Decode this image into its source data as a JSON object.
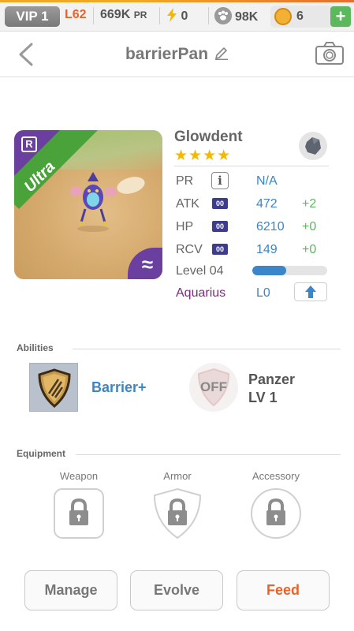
{
  "status_bar": {
    "vip": "VIP 1",
    "level": "L62",
    "power": "669K",
    "power_unit": "PR",
    "energy": "0",
    "paw_count": "98K",
    "coins": "6",
    "add": "+"
  },
  "header": {
    "title": "barrierPan",
    "icons": [
      "back-chevron-icon",
      "pencil-icon",
      "camera-icon"
    ]
  },
  "monster": {
    "rarity": "Ultra",
    "rarity_badge": "R",
    "element_symbol": "≈",
    "name": "Glowdent",
    "stars": "★★★★",
    "star_count": 4,
    "stats": [
      {
        "label": "PR",
        "value": "N/A",
        "bonus": ""
      },
      {
        "label": "ATK",
        "tag": "00",
        "value": "472",
        "bonus": "+2"
      },
      {
        "label": "HP",
        "tag": "00",
        "value": "6210",
        "bonus": "+0"
      },
      {
        "label": "RCV",
        "tag": "00",
        "value": "149",
        "bonus": "+0"
      }
    ],
    "info_icon": "i",
    "level_label": "Level 04",
    "level_progress": 0.45,
    "zodiac": "Aquarius",
    "zodiac_level": "L0"
  },
  "abilities": {
    "heading": "Abilities",
    "primary": {
      "name": "Barrier+"
    },
    "secondary": {
      "status": "OFF",
      "name": "Panzer",
      "level": "LV 1"
    }
  },
  "equipment": {
    "heading": "Equipment",
    "slots": [
      "Weapon",
      "Armor",
      "Accessory"
    ]
  },
  "actions": {
    "manage": "Manage",
    "evolve": "Evolve",
    "feed": "Feed"
  },
  "colors": {
    "accent_orange": "#e8632a",
    "stat_blue": "#3a86c8",
    "bonus_green": "#5bb85c",
    "rarity_purple": "#6b3fa0",
    "ribbon_green": "#4aa33a",
    "zodiac_purple": "#7a2d7e"
  }
}
